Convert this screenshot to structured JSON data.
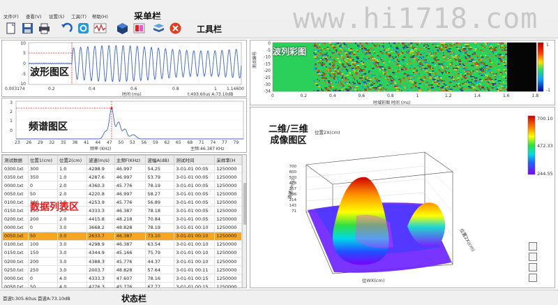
{
  "watermark": "www.hi1718.com",
  "menu": {
    "items": [
      "文件(F)",
      "查看(V)",
      "设置(S)",
      "工具(T)",
      "帮助(H)"
    ],
    "annotation": "采单栏"
  },
  "toolbar": {
    "annotation": "工具栏",
    "buttons": [
      "new-icon",
      "save-icon",
      "print-icon",
      "undo-icon",
      "settings-icon",
      "waveform-icon",
      "cube-icon",
      "color-icon",
      "book-icon",
      "close-icon"
    ]
  },
  "waveform": {
    "annotation": "波形图区",
    "xlabel": "时间 (ms)",
    "ticks_y": [
      "10",
      "5",
      "0",
      "-5",
      "-10"
    ],
    "ticks_x": [
      "0.003174",
      "0.2",
      "0.4",
      "0.6",
      "0.8",
      "1",
      "1.14600"
    ],
    "readout": "t:493.60us A:73.10dB"
  },
  "spectrum": {
    "annotation": "频谱图区",
    "xlabel": "频率 (KHz)",
    "ticks_y": [
      "3",
      "2",
      "1",
      "0"
    ],
    "ticks_x": [
      "23",
      "26",
      "29",
      "32",
      "35",
      "38",
      "41",
      "44",
      "47",
      "50",
      "53",
      "56",
      "59",
      "62",
      "65",
      "68",
      "71",
      "74",
      "77",
      "79"
    ],
    "readout": "主频:46.387 KHz"
  },
  "table": {
    "annotation": "数据列表区",
    "headers": [
      "测试数据",
      "位置1(cm)",
      "位置2(cm)",
      "波速(m/s)",
      "主频F(KHz)",
      "波幅A(dB)",
      "测试时间",
      "采样率(H"
    ],
    "rows": [
      [
        "0300.txt",
        "300",
        "1.0",
        "4298.9",
        "46.997",
        "54.25",
        "3-01-01 00:05",
        "1250000"
      ],
      [
        "0350.txt",
        "350",
        "1.0",
        "4287.6",
        "46.997",
        "53.79",
        "3-01-01 00:05",
        "1250000"
      ],
      [
        "0000.txt",
        "0",
        "2.0",
        "4360.3",
        "45.776",
        "78.19",
        "3-01-01 00:05",
        "1250000"
      ],
      [
        "0050.txt",
        "50",
        "2.0",
        "4220.8",
        "46.997",
        "58.27",
        "3-01-01 00:05",
        "1250000"
      ],
      [
        "0100.txt",
        "100",
        "2.0",
        "4253.9",
        "45.776",
        "56.89",
        "3-01-01 00:05",
        "1250000"
      ],
      [
        "0150.txt",
        "150",
        "2.0",
        "4333.3",
        "46.387",
        "78.18",
        "3-01-01 00:05",
        "1250000"
      ],
      [
        "0200.txt",
        "200",
        "2.0",
        "4415.8",
        "48.218",
        "70.84",
        "3-01-01 00:05",
        "1250000"
      ],
      [
        "0000.txt",
        "0",
        "3.0",
        "3668.2",
        "48.828",
        "78.19",
        "3-01-01 00:10",
        "1250000"
      ],
      [
        "0050.txt",
        "50",
        "3.0",
        "2633.7",
        "46.387",
        "73.10",
        "3-01-01 00:10",
        "1250000"
      ],
      [
        "0100.txt",
        "100",
        "3.0",
        "4298.9",
        "46.387",
        "63.54",
        "3-01-01 00:10",
        "1250000"
      ],
      [
        "0150.txt",
        "150",
        "3.0",
        "4344.9",
        "45.166",
        "75.79",
        "3-01-01 00:10",
        "1250000"
      ],
      [
        "0200.txt",
        "200",
        "3.0",
        "4388.3",
        "45.776",
        "44.37",
        "3-01-01 00:10",
        "1250000"
      ],
      [
        "0250.txt",
        "250",
        "3.0",
        "2003.7",
        "48.828",
        "57.64",
        "3-01-01 00:11",
        "1250000"
      ],
      [
        "0000.txt",
        "0",
        "4.0",
        "4333.3",
        "47.607",
        "78.16",
        "3-01-01 00:15",
        "1250000"
      ],
      [
        "0050.txt",
        "50",
        "4.0",
        "4276.3",
        "45.776",
        "67.77",
        "3-01-01 00:15",
        "1250000"
      ]
    ],
    "selected_row": 8
  },
  "bscan": {
    "annotation": "波列彩图",
    "ylabel": "测点编号",
    "xlabel": "时域彩图 时间 (ms)",
    "ticks_y": [
      "0",
      "-5",
      "-10",
      "-15",
      "-20",
      "-25",
      "-30",
      "-34"
    ],
    "ticks_x": [
      "0",
      "0.2",
      "0.4",
      "0.6",
      "0.8",
      "1",
      "1.2",
      "1.4",
      "1.6",
      "1.8"
    ],
    "colorbar_top": "1",
    "colorbar_bottom": "-1"
  },
  "surface": {
    "annotation": "二维/三维\n成像图区",
    "colorbar_max": "700.10",
    "colorbar_mid": "472.33",
    "colorbar_min": "244.55",
    "z_ticks": [
      "700",
      "600",
      "500",
      "428",
      "357",
      "286",
      "214",
      "143",
      "71"
    ],
    "xlabel": "位WX(cm)",
    "ylabel": "位置2X(cm)",
    "zlabel": "波速(m/s)"
  },
  "status": {
    "text": "首波t:305.60us 首波A:73.10dB",
    "annotation": "状态栏"
  }
}
